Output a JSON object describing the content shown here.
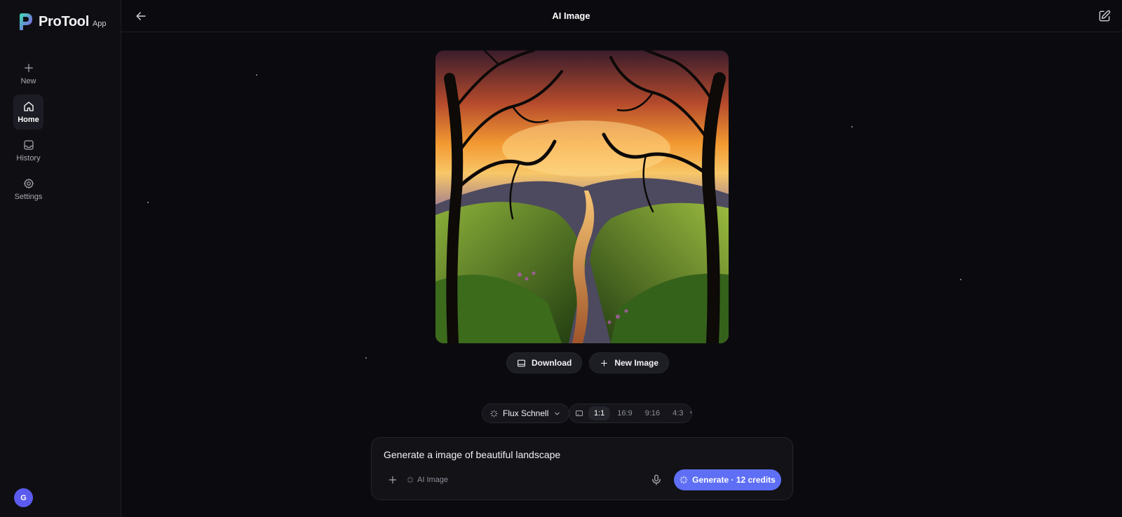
{
  "brand": {
    "name": "ProTool",
    "suffix": "App",
    "accent": "#5e6ff5"
  },
  "sidebar": {
    "items": [
      {
        "label": "New",
        "icon": "plus-icon",
        "active": false
      },
      {
        "label": "Home",
        "icon": "home-icon",
        "active": true
      },
      {
        "label": "History",
        "icon": "inbox-icon",
        "active": false
      },
      {
        "label": "Settings",
        "icon": "gear-icon",
        "active": false
      }
    ],
    "avatar_initial": "G"
  },
  "header": {
    "title": "AI Image",
    "back_icon": "arrow-left-icon",
    "edit_icon": "edit-icon"
  },
  "image": {
    "subject": "landscape"
  },
  "actions": {
    "download_label": "Download",
    "new_image_label": "New Image"
  },
  "settings": {
    "model": "Flux Schnell",
    "aspect_ratios": [
      "1:1",
      "16:9",
      "9:16",
      "4:3"
    ],
    "selected_ratio": "1:1"
  },
  "prompt": {
    "value": "Generate a image of beautiful landscape",
    "mode_label": "AI Image",
    "generate_label": "Generate · 12 credits"
  }
}
